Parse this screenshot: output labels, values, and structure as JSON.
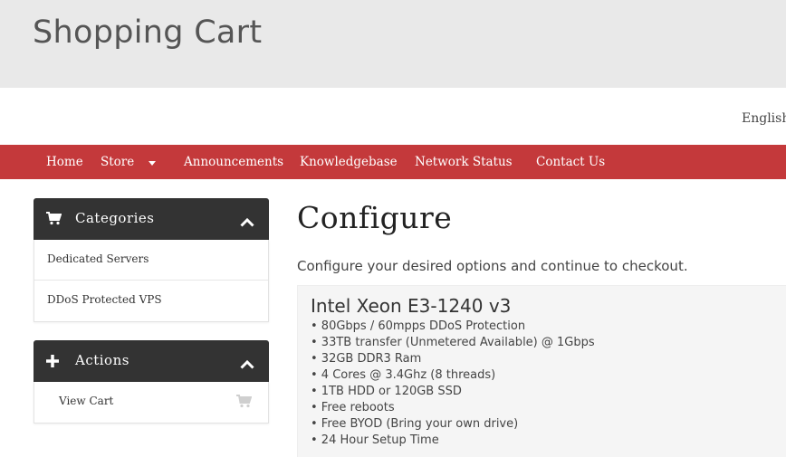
{
  "header": {
    "title": "Shopping Cart"
  },
  "language": {
    "label": "English"
  },
  "nav": {
    "items": [
      {
        "label": "Home"
      },
      {
        "label": "Store"
      },
      {
        "label": "Announcements"
      },
      {
        "label": "Knowledgebase"
      },
      {
        "label": "Network Status"
      },
      {
        "label": "Contact Us"
      }
    ],
    "store_has_dropdown": true
  },
  "sidebar": {
    "categories": {
      "title": "Categories",
      "icon": "shopping-cart-icon",
      "items": [
        {
          "label": "Dedicated Servers"
        },
        {
          "label": "DDoS Protected VPS"
        }
      ]
    },
    "actions": {
      "title": "Actions",
      "icon": "plus-icon",
      "items": [
        {
          "label": "View Cart",
          "icon": "shopping-cart-icon"
        }
      ]
    }
  },
  "main": {
    "heading": "Configure",
    "subheading": "Configure your desired options and continue to checkout.",
    "product": {
      "name": "Intel Xeon E3-1240 v3",
      "features": [
        "• 80Gbps / 60mpps DDoS Protection",
        "• 33TB transfer (Unmetered Available) @ 1Gbps",
        "• 32GB DDR3 Ram",
        "• 4 Cores @ 3.4Ghz (8 threads)",
        "• 1TB HDD or 120GB SSD",
        "• Free reboots",
        "• Free BYOD (Bring your own drive)",
        "• 24 Hour Setup Time"
      ]
    }
  },
  "colors": {
    "nav_bg": "#c4393b",
    "panel_head_bg": "#333333",
    "header_bg": "#e9e9e9"
  }
}
